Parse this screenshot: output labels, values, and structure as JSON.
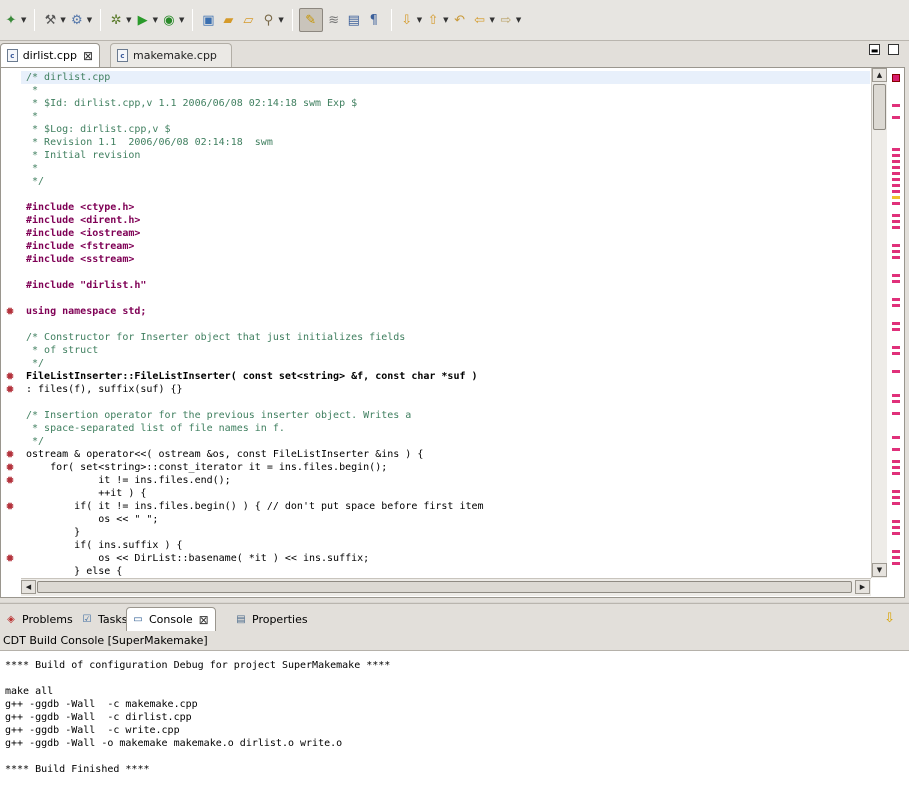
{
  "toolbar": {
    "items": [
      "new-connection-icon",
      "build-icon",
      "build-target-icon",
      "debug-icon",
      "run-icon",
      "external-tools-icon",
      "open-type-icon",
      "open-project-icon",
      "open-file-icon",
      "search-icon",
      "toggle-mark-occurrences-icon",
      "toggle-block-selection-icon",
      "show-whitespace-icon",
      "show-paragraph-icon",
      "next-annotation-icon",
      "previous-annotation-icon",
      "last-edit-icon",
      "back-icon",
      "forward-icon"
    ]
  },
  "editor": {
    "tabs": [
      {
        "label": "dirlist.cpp",
        "active": true
      },
      {
        "label": "makemake.cpp",
        "active": false
      }
    ],
    "lines": [
      "/* dirlist.cpp",
      " *",
      " * $Id: dirlist.cpp,v 1.1 2006/06/08 02:14:18 swm Exp $",
      " *",
      " * $Log: dirlist.cpp,v $",
      " * Revision 1.1  2006/06/08 02:14:18  swm",
      " * Initial revision",
      " *",
      " */",
      "",
      "#include <ctype.h>",
      "#include <dirent.h>",
      "#include <iostream>",
      "#include <fstream>",
      "#include <sstream>",
      "",
      "#include \"dirlist.h\"",
      "",
      "using namespace std;",
      "",
      "/* Constructor for Inserter object that just initializes fields",
      " * of struct",
      " */",
      "FileListInserter::FileListInserter( const set<string> &f, const char *suf )",
      ": files(f), suffix(suf) {}",
      "",
      "/* Insertion operator for the previous inserter object. Writes a",
      " * space-separated list of file names in f.",
      " */",
      "ostream & operator<<( ostream &os, const FileListInserter &ins ) {",
      "    for( set<string>::const_iterator it = ins.files.begin();",
      "            it != ins.files.end();",
      "            ++it ) {",
      "        if( it != ins.files.begin() ) { // don't put space before first item",
      "            os << \" \";",
      "        }",
      "        if( ins.suffix ) {",
      "            os << DirList::basename( *it ) << ins.suffix;",
      "        } else {"
    ]
  },
  "panel": {
    "tabs": [
      {
        "label": "Problems",
        "icon": "problems-icon"
      },
      {
        "label": "Tasks",
        "icon": "tasks-icon"
      },
      {
        "label": "Console",
        "icon": "console-icon",
        "active": true
      },
      {
        "label": "Properties",
        "icon": "properties-icon"
      }
    ],
    "console_title": "CDT Build Console [SuperMakemake]",
    "console_lines": [
      "**** Build of configuration Debug for project SuperMakemake ****",
      "",
      "make all",
      "g++ -ggdb -Wall  -c makemake.cpp",
      "g++ -ggdb -Wall  -c dirlist.cpp",
      "g++ -ggdb -Wall  -c write.cpp",
      "g++ -ggdb -Wall -o makemake makemake.o dirlist.o write.o",
      "",
      "**** Build Finished ****"
    ]
  }
}
